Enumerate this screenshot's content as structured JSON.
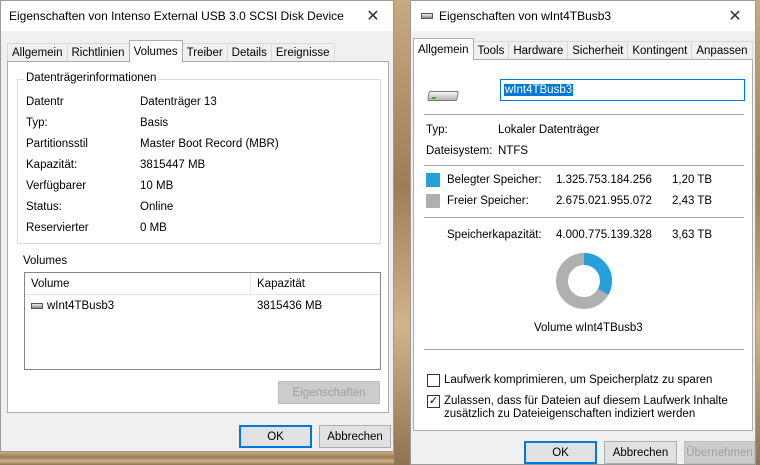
{
  "left_window": {
    "title": "Eigenschaften von Intenso External USB 3.0 SCSI Disk Device",
    "tabs": [
      "Allgemein",
      "Richtlinien",
      "Volumes",
      "Treiber",
      "Details",
      "Ereignisse"
    ],
    "active_tab": "Volumes",
    "disk_info": {
      "group_title": "Datenträgerinformationen",
      "rows": [
        {
          "label": "Datentr",
          "value": "Datenträger 13"
        },
        {
          "label": "Typ:",
          "value": "Basis"
        },
        {
          "label": "Partitionsstil",
          "value": "Master Boot Record (MBR)"
        },
        {
          "label": "Kapazität:",
          "value": "3815447 MB"
        },
        {
          "label": "Verfügbarer",
          "value": "10 MB"
        },
        {
          "label": "Status:",
          "value": "Online"
        },
        {
          "label": "Reservierter",
          "value": "0 MB"
        }
      ]
    },
    "volumes": {
      "group_title": "Volumes",
      "columns": [
        "Volume",
        "Kapazität"
      ],
      "rows": [
        {
          "volume": "wInt4TBusb3",
          "capacity": "3815436 MB"
        }
      ]
    },
    "properties_button": "Eigenschaften",
    "ok_button": "OK",
    "cancel_button": "Abbrechen"
  },
  "right_window": {
    "title": "Eigenschaften von wInt4TBusb3",
    "tabs": [
      "Allgemein",
      "Tools",
      "Hardware",
      "Sicherheit",
      "Kontingent",
      "Anpassen"
    ],
    "active_tab": "Allgemein",
    "name_value": "wInt4TBusb3",
    "type_label": "Typ:",
    "type_value": "Lokaler Datenträger",
    "fs_label": "Dateisystem:",
    "fs_value": "NTFS",
    "used": {
      "label": "Belegter Speicher:",
      "bytes": "1.325.753.184.256",
      "size": "1,20 TB",
      "color": "#26a0da"
    },
    "free": {
      "label": "Freier Speicher:",
      "bytes": "2.675.021.955.072",
      "size": "2,43 TB",
      "color": "#b0b0b0"
    },
    "capacity": {
      "label": "Speicherkapazität:",
      "bytes": "4.000.775.139.328",
      "size": "3,63 TB"
    },
    "used_fraction": 0.3314,
    "volume_caption": "Volume wInt4TBusb3",
    "compress_label": "Laufwerk komprimieren, um Speicherplatz zu sparen",
    "compress_checked": false,
    "index_label_line1": "Zulassen, dass für Dateien auf diesem Laufwerk Inhalte",
    "index_label_line2": "zusätzlich zu Dateieigenschaften indiziert werden",
    "index_checked": true,
    "checkmark": "✓",
    "ok_button": "OK",
    "cancel_button": "Abbrechen",
    "apply_button": "Übernehmen"
  }
}
